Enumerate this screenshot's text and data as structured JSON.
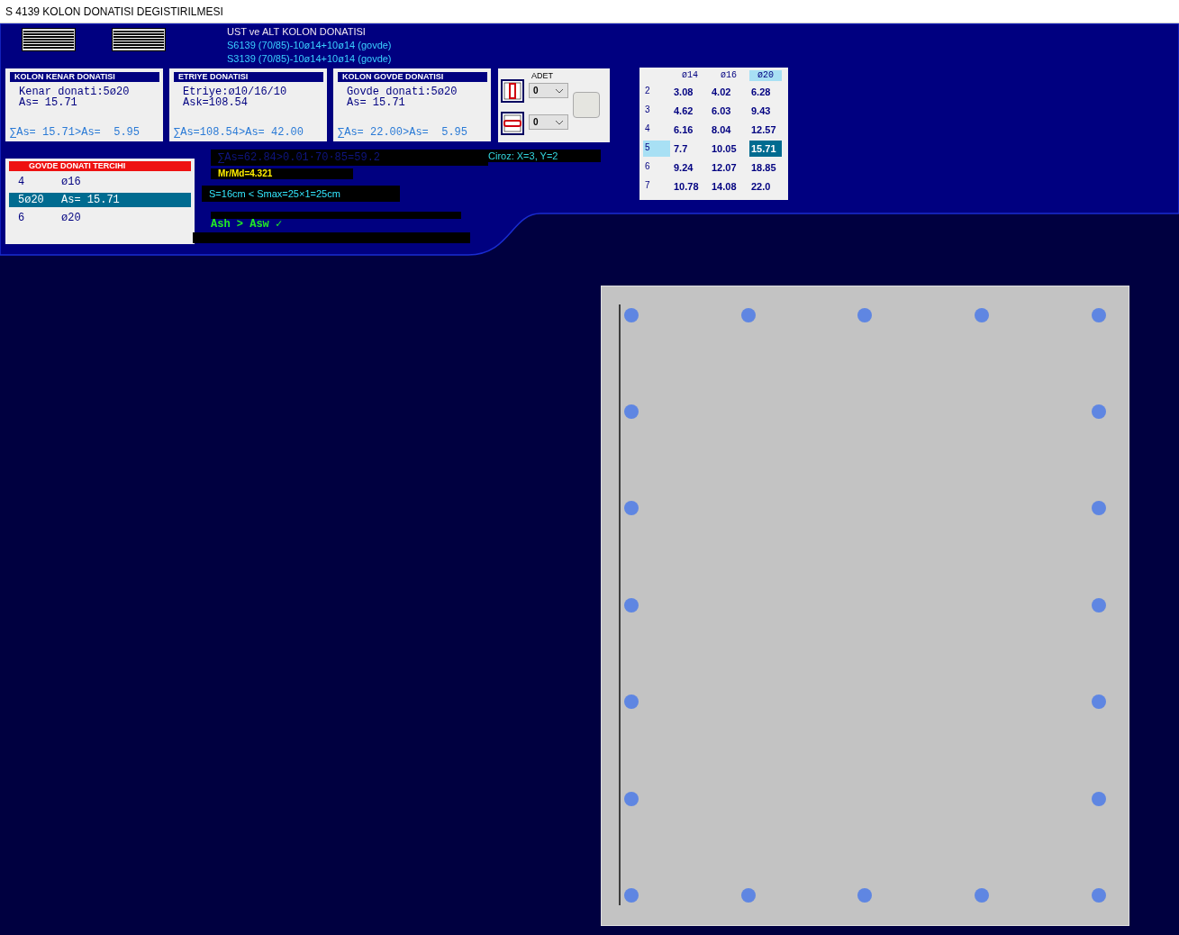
{
  "window": {
    "title": "S 4139 KOLON DONATISI DEGISTIRILMESI"
  },
  "column_info": {
    "title": "UST ve ALT KOLON DONATISI",
    "lines": [
      "S6139 (70/85)-10ø14+10ø14 (govde)",
      "S3139 (70/85)-10ø14+10ø14 (govde)"
    ]
  },
  "cards": [
    {
      "title": "KOLON KENAR DONATISI",
      "lines": [
        "Kenar donati:5ø20",
        "As= 15.71"
      ],
      "sum": "∑As= 15.71>As=  5.95"
    },
    {
      "title": "ETRIYE DONATISI",
      "lines": [
        "Etriye:ø10/16/10",
        "Ask=108.54"
      ],
      "sum": "∑As=108.54>As= 42.00"
    },
    {
      "title": "KOLON GOVDE DONATISI",
      "lines": [
        "Govde donati:5ø20",
        "As= 15.71"
      ],
      "sum": "∑As= 22.00>As=  5.95"
    }
  ],
  "adet": {
    "label": "ADET",
    "dropdowns": [
      {
        "kind": "vertical",
        "value": "0"
      },
      {
        "kind": "horizontal",
        "value": "0"
      }
    ]
  },
  "table": {
    "columns": [
      {
        "label": "ø14",
        "selected": false
      },
      {
        "label": "ø16",
        "selected": false
      },
      {
        "label": "ø20",
        "selected": true
      }
    ],
    "rows": [
      {
        "label": "2",
        "selected": false,
        "cells": [
          "3.08",
          "4.02",
          "6.28"
        ]
      },
      {
        "label": "3",
        "selected": false,
        "cells": [
          "4.62",
          "6.03",
          "9.43"
        ]
      },
      {
        "label": "4",
        "selected": false,
        "cells": [
          "6.16",
          "8.04",
          "12.57"
        ]
      },
      {
        "label": "5",
        "selected": true,
        "cells": [
          "7.7",
          "10.05",
          "15.71"
        ]
      },
      {
        "label": "6",
        "selected": false,
        "cells": [
          "9.24",
          "12.07",
          "18.85"
        ]
      },
      {
        "label": "7",
        "selected": false,
        "cells": [
          "10.78",
          "14.08",
          "22.0"
        ]
      }
    ]
  },
  "govde_tercihi": {
    "title": "GOVDE DONATI TERCIHI",
    "options": [
      {
        "column_1": "4",
        "column_2": "ø16",
        "selected": false
      },
      {
        "column_1": "5ø20",
        "column_2": "As= 15.71",
        "selected": true
      },
      {
        "column_1": "6",
        "column_2": "ø20",
        "selected": false
      }
    ]
  },
  "checks": [
    {
      "kind": "sum",
      "text": "∑As=62.84>0.01·70·85=59.2"
    },
    {
      "kind": "ratio",
      "text": "Mr/Md=4.321"
    },
    {
      "kind": "spacing",
      "text": "S=16cm < Smax=25×1=25cm"
    },
    {
      "kind": "ash",
      "text": "Ash > Asw ✓"
    }
  ],
  "ciroz": "Ciroz: X=3, Y=2"
}
